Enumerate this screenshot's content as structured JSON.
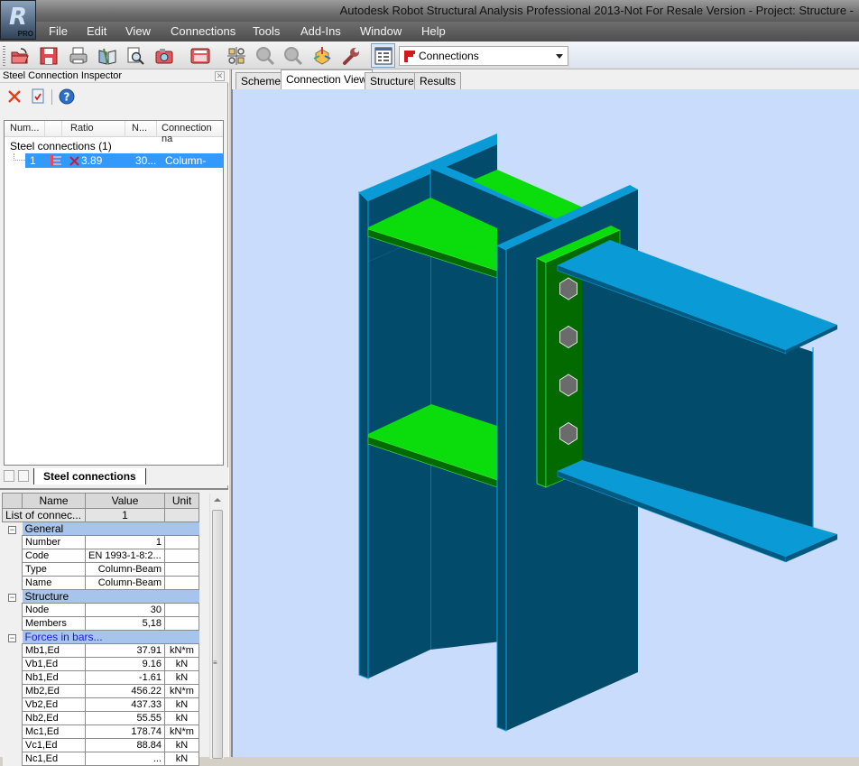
{
  "app": {
    "title": "Autodesk Robot Structural Analysis Professional 2013-Not For Resale Version - Project: Structure -",
    "logo_text": "PRO"
  },
  "menu": [
    "File",
    "Edit",
    "View",
    "Connections",
    "Tools",
    "Add-Ins",
    "Window",
    "Help"
  ],
  "toolbar": {
    "icons": [
      "open-icon",
      "save-icon",
      "print-icon",
      "book-icon",
      "preview-icon",
      "camera-icon",
      "calculator-icon",
      "zoom-views-icon",
      "zoom-window-icon",
      "zoom-out-icon",
      "view-3d-icon",
      "tools-wrench-icon",
      "inspector-toggle-icon"
    ],
    "layout_combo": {
      "value": "Connections",
      "icon": "connection-flag-icon"
    }
  },
  "inspector": {
    "title": "Steel Connection Inspector",
    "tools": [
      "delete-icon",
      "calc-note-icon",
      "help-icon"
    ],
    "columns": [
      "Num...",
      "Ratio",
      "N...",
      "Connection na"
    ],
    "group_label": "Steel connections (1)",
    "rows": [
      {
        "number": "1",
        "status": "failed",
        "ratio": "3.89",
        "node": "30...",
        "name": "Column-Beam"
      }
    ],
    "sheet_tab": "Steel connections"
  },
  "properties": {
    "headers": [
      "Name",
      "Value",
      "Unit"
    ],
    "top_row": {
      "name": "List of connec...",
      "value": "1",
      "unit": ""
    },
    "categories": [
      {
        "label": "General",
        "rows": [
          {
            "name": "Number",
            "value": "1",
            "unit": ""
          },
          {
            "name": "Code",
            "value": "EN 1993-1-8:2...",
            "unit": ""
          },
          {
            "name": "Type",
            "value": "Column-Beam",
            "unit": ""
          },
          {
            "name": "Name",
            "value": "Column-Beam",
            "unit": ""
          }
        ]
      },
      {
        "label": "Structure",
        "rows": [
          {
            "name": "Node",
            "value": "30",
            "unit": ""
          },
          {
            "name": "Members",
            "value": "5,18",
            "unit": ""
          }
        ]
      },
      {
        "label": "Forces in bars...",
        "rows": [
          {
            "name": "Mb1,Ed",
            "value": "37.91",
            "unit": "kN*m"
          },
          {
            "name": "Vb1,Ed",
            "value": "9.16",
            "unit": "kN"
          },
          {
            "name": "Nb1,Ed",
            "value": "-1.61",
            "unit": "kN"
          },
          {
            "name": "Mb2,Ed",
            "value": "456.22",
            "unit": "kN*m"
          },
          {
            "name": "Vb2,Ed",
            "value": "437.33",
            "unit": "kN"
          },
          {
            "name": "Nb2,Ed",
            "value": "55.55",
            "unit": "kN"
          },
          {
            "name": "Mc1,Ed",
            "value": "178.74",
            "unit": "kN*m"
          },
          {
            "name": "Vc1,Ed",
            "value": "88.84",
            "unit": "kN"
          },
          {
            "name": "Nc1,Ed",
            "value": "...",
            "unit": "kN"
          }
        ]
      }
    ]
  },
  "view": {
    "tabs": [
      "Scheme",
      "Connection View",
      "Structure",
      "Results"
    ],
    "active_tab": "Connection View",
    "colors": {
      "background": "#cadcfb",
      "steel_face": "#034b6b",
      "steel_edge": "#0aa0dc",
      "stiffener": "#0bdc0b",
      "end_plate": "#036a00",
      "bolt": "#6b6b6b"
    },
    "bolt_count": 4
  }
}
